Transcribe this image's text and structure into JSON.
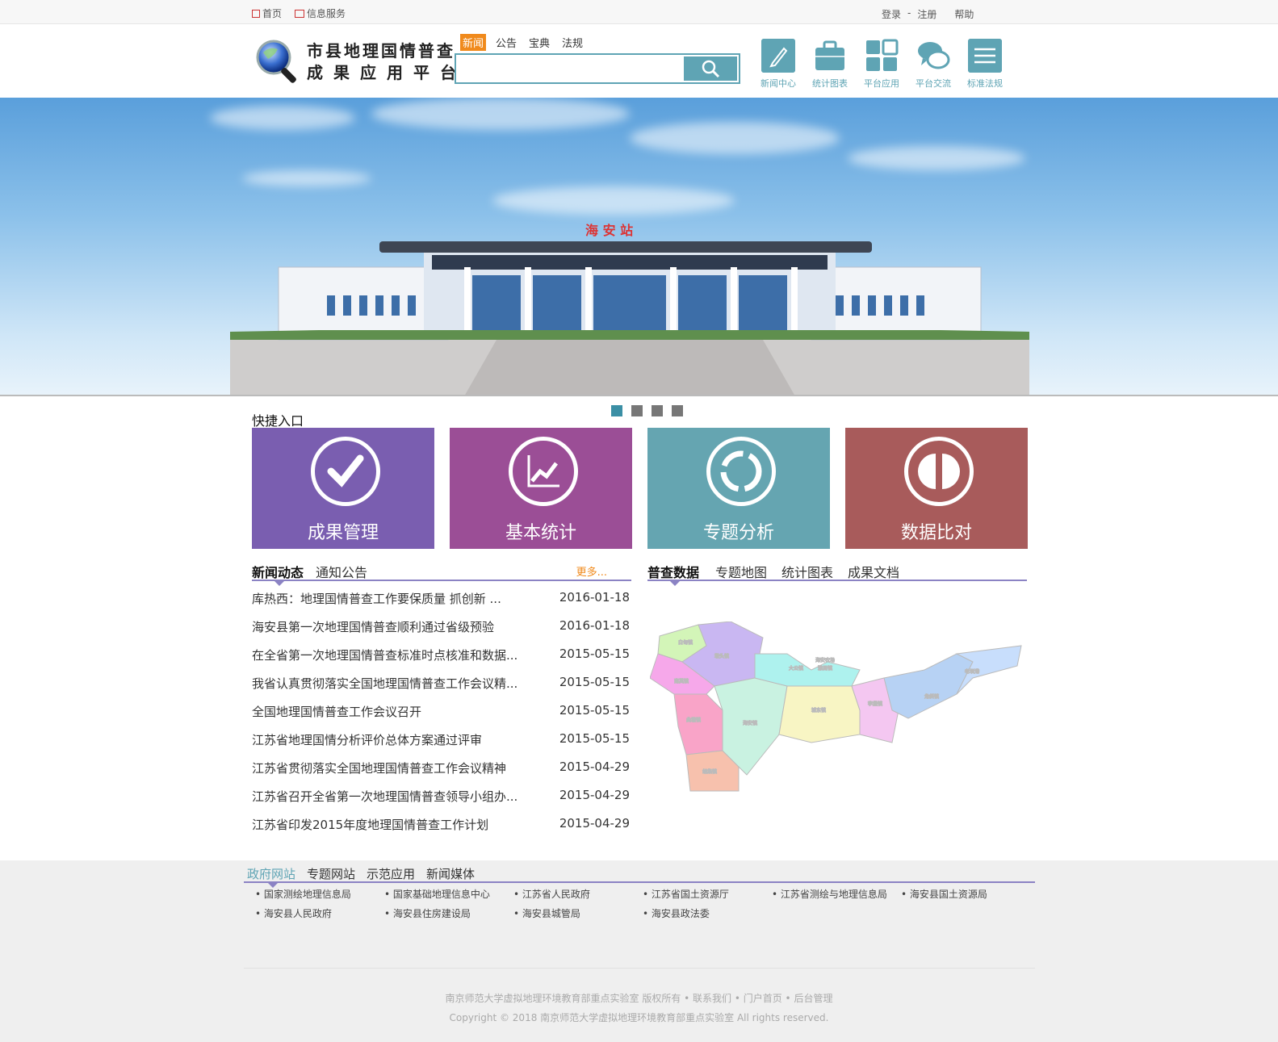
{
  "topbar": {
    "home": "首页",
    "info_service": "信息服务",
    "login": "登录",
    "sep": "-",
    "register": "注册",
    "help": "帮助"
  },
  "header": {
    "title_line1": "市县地理国情普查",
    "title_line2": "成果应用平台",
    "search_tabs": [
      "新闻",
      "公告",
      "宝典",
      "法规"
    ],
    "search_placeholder": "",
    "nav_icons": [
      {
        "label": "新闻中心",
        "icon": "pen-icon"
      },
      {
        "label": "统计图表",
        "icon": "briefcase-icon"
      },
      {
        "label": "平台应用",
        "icon": "grid-icon"
      },
      {
        "label": "平台交流",
        "icon": "chat-icon"
      },
      {
        "label": "标准法规",
        "icon": "list-icon"
      }
    ]
  },
  "banner": {
    "station_sign": "海 安 站",
    "dots": 4,
    "active_dot": 0
  },
  "quick_entry": {
    "title": "快捷入口",
    "tiles": [
      {
        "label": "成果管理",
        "color": "#7a5eb0",
        "icon": "check-icon"
      },
      {
        "label": "基本统计",
        "color": "#9b4e96",
        "icon": "chart-icon"
      },
      {
        "label": "专题分析",
        "color": "#65a5b1",
        "icon": "cycle-icon"
      },
      {
        "label": "数据比对",
        "color": "#a85b5b",
        "icon": "compare-icon"
      }
    ]
  },
  "news": {
    "tabs": [
      "新闻动态",
      "通知公告"
    ],
    "more": "更多...",
    "items": [
      {
        "title": "库热西：地理国情普查工作要保质量 抓创新 ...",
        "date": "2016-01-18"
      },
      {
        "title": "海安县第一次地理国情普查顺利通过省级预验",
        "date": "2016-01-18"
      },
      {
        "title": "在全省第一次地理国情普查标准时点核准和数据...",
        "date": "2015-05-15"
      },
      {
        "title": "我省认真贯彻落实全国地理国情普查工作会议精...",
        "date": "2015-05-15"
      },
      {
        "title": "全国地理国情普查工作会议召开",
        "date": "2015-05-15"
      },
      {
        "title": "江苏省地理国情分析评价总体方案通过评审",
        "date": "2015-05-15"
      },
      {
        "title": "江苏省贯彻落实全国地理国情普查工作会议精神",
        "date": "2015-04-29"
      },
      {
        "title": "江苏省召开全省第一次地理国情普查领导小组办...",
        "date": "2015-04-29"
      },
      {
        "title": "江苏省印发2015年度地理国情普查工作计划",
        "date": "2015-04-29"
      }
    ]
  },
  "data_panel": {
    "tabs": [
      "普查数据",
      "专题地图",
      "统计图表",
      "成果文档"
    ],
    "map_labels": [
      "白甸镇",
      "墩头镇",
      "南莫镇",
      "大公镇",
      "海安农场",
      "雅周镇",
      "海安镇",
      "城东镇",
      "李堡镇",
      "角斜镇",
      "老坝港",
      "曲塘镇",
      "胡集镇"
    ]
  },
  "footer": {
    "tabs": [
      "政府网站",
      "专题网站",
      "示范应用",
      "新闻媒体"
    ],
    "links": [
      "国家测绘地理信息局",
      "国家基础地理信息中心",
      "江苏省人民政府",
      "江苏省国土资源厅",
      "江苏省测绘与地理信息局",
      "海安县国土资源局",
      "海安县人民政府",
      "海安县住房建设局",
      "海安县城管局",
      "海安县政法委"
    ],
    "line1": "南京师范大学虚拟地理环境教育部重点实验室 版权所有 • 联系我们 • 门户首页 • 后台管理",
    "line2": "Copyright © 2018 南京师范大学虚拟地理环境教育部重点实验室 All rights reserved."
  }
}
